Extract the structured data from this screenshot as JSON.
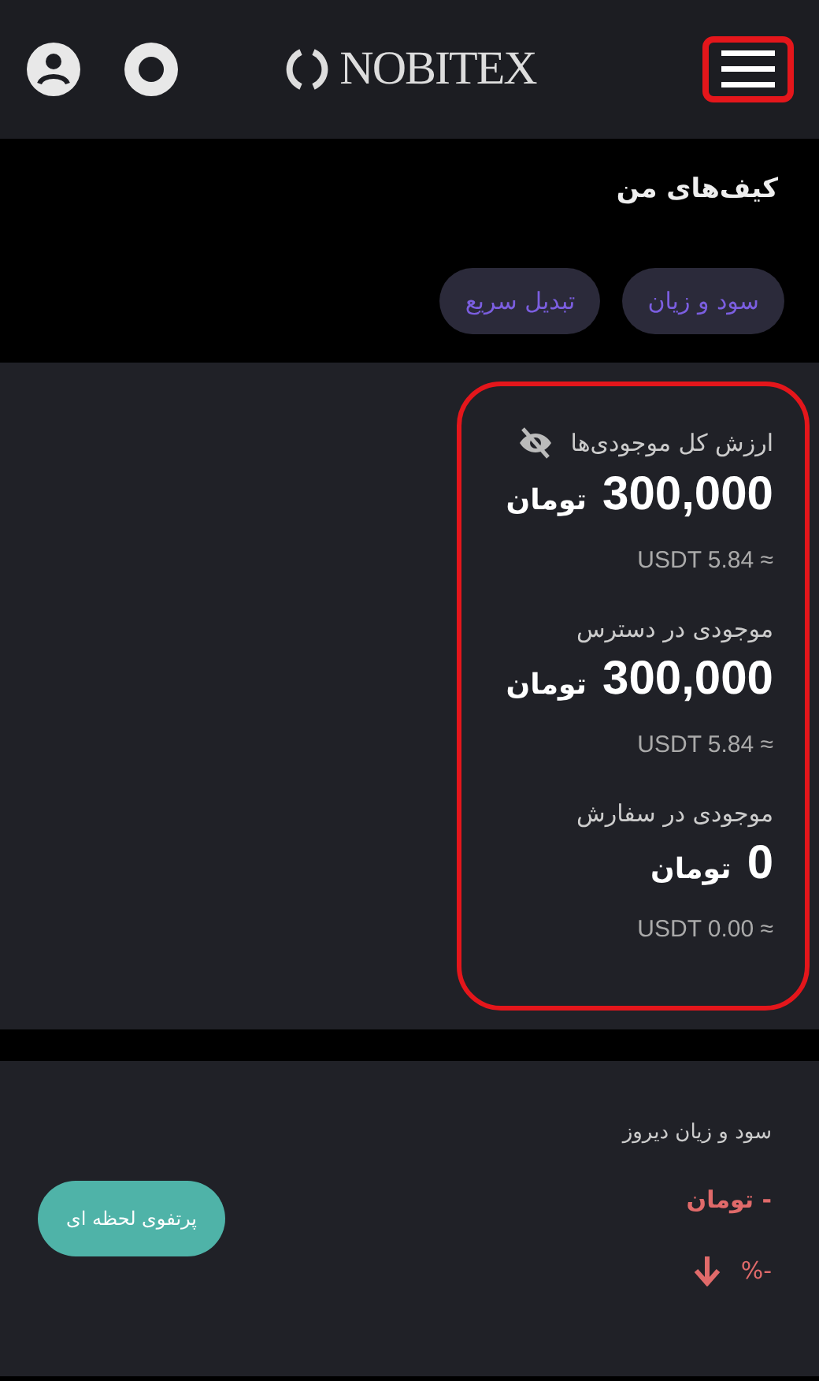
{
  "header": {
    "logo": "NOBITEX",
    "menu_highlighted": true
  },
  "page_title": "کیف‌های من",
  "actions": [
    {
      "label": "سود و زیان"
    },
    {
      "label": "تبدیل سریع"
    }
  ],
  "summary": {
    "highlighted": true,
    "items": [
      {
        "label": "ارزش کل موجودی‌ها",
        "hidden_toggle": true,
        "amount": "300,000",
        "unit": "تومان",
        "usdt": "USDT 5.84 ≈"
      },
      {
        "label": "موجودی در دسترس",
        "hidden_toggle": false,
        "amount": "300,000",
        "unit": "تومان",
        "usdt": "USDT 5.84 ≈"
      },
      {
        "label": "موجودی در سفارش",
        "hidden_toggle": false,
        "amount": "0",
        "unit": "تومان",
        "usdt": "USDT 0.00 ≈"
      }
    ]
  },
  "pnl": {
    "label": "سود و زیان دیروز",
    "amount": "- تومان",
    "percent": "-%",
    "button": "پرتفوی لحظه ای"
  }
}
